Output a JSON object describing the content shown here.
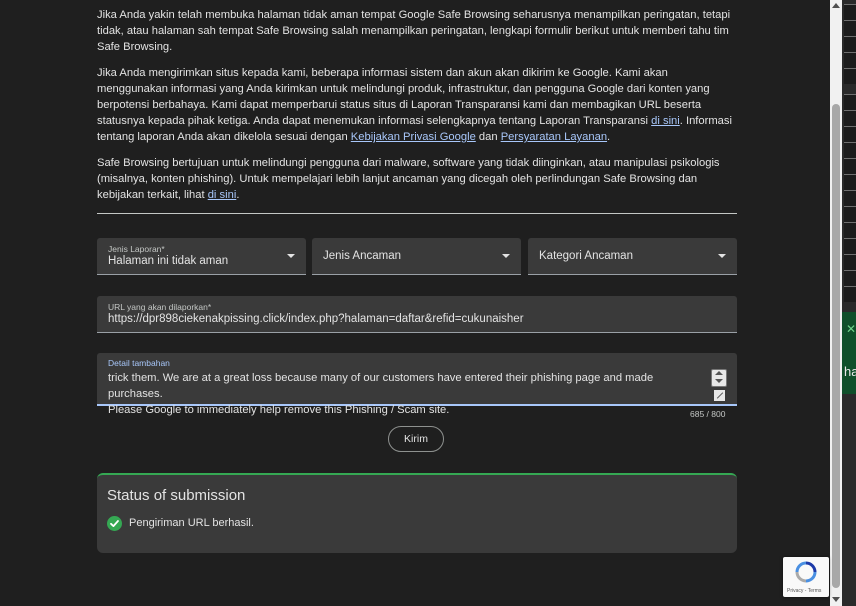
{
  "intro": {
    "p1": "Jika Anda yakin telah membuka halaman tidak aman tempat Google Safe Browsing seharusnya menampilkan peringatan, tetapi tidak, atau halaman sah tempat Safe Browsing salah menampilkan peringatan, lengkapi formulir berikut untuk memberi tahu tim Safe Browsing.",
    "p2_a": "Jika Anda mengirimkan situs kepada kami, beberapa informasi sistem dan akun akan dikirim ke Google. Kami akan menggunakan informasi yang Anda kirimkan untuk melindungi produk, infrastruktur, dan pengguna Google dari konten yang berpotensi berbahaya. Kami dapat memperbarui status situs di Laporan Transparansi kami dan membagikan URL beserta statusnya kepada pihak ketiga. Anda dapat menemukan informasi selengkapnya tentang Laporan Transparansi ",
    "p2_link1": "di sini",
    "p2_b": ". Informasi tentang laporan Anda akan dikelola sesuai dengan ",
    "p2_link2": "Kebijakan Privasi Google",
    "p2_c": " dan ",
    "p2_link3": "Persyaratan Layanan",
    "p2_d": ".",
    "p3_a": "Safe Browsing bertujuan untuk melindungi pengguna dari malware, software yang tidak diinginkan, atau manipulasi psikologis (misalnya, konten phishing). Untuk mempelajari lebih lanjut ancaman yang dicegah oleh perlindungan Safe Browsing dan kebijakan terkait, lihat ",
    "p3_link": "di sini",
    "p3_b": "."
  },
  "form": {
    "report_type": {
      "label": "Jenis Laporan*",
      "value": "Halaman ini tidak aman"
    },
    "threat_type": {
      "placeholder": "Jenis Ancaman"
    },
    "threat_category": {
      "placeholder": "Kategori Ancaman"
    },
    "url": {
      "label": "URL yang akan dilaporkan*",
      "value": "https://dpr898ciekenakpissing.click/index.php?halaman=daftar&refid=cukunaisher"
    },
    "details": {
      "label": "Detail tambahan",
      "value": "trick them. We are at a great loss because many of our customers have entered their phishing page and made purchases.\nPlease Google to immediately help remove this Phishing / Scam site.",
      "counter": "685 / 800"
    },
    "submit_label": "Kirim"
  },
  "status": {
    "title": "Status of submission",
    "message": "Pengiriman URL berhasil."
  },
  "recaptcha": {
    "terms": "Privacy - Terms"
  },
  "backdrop": {
    "partial_text": "ha"
  },
  "colors": {
    "accent": "#a8c7fa",
    "success": "#35a853",
    "surface": "#3a3a3a",
    "background": "#1f1f1f"
  }
}
